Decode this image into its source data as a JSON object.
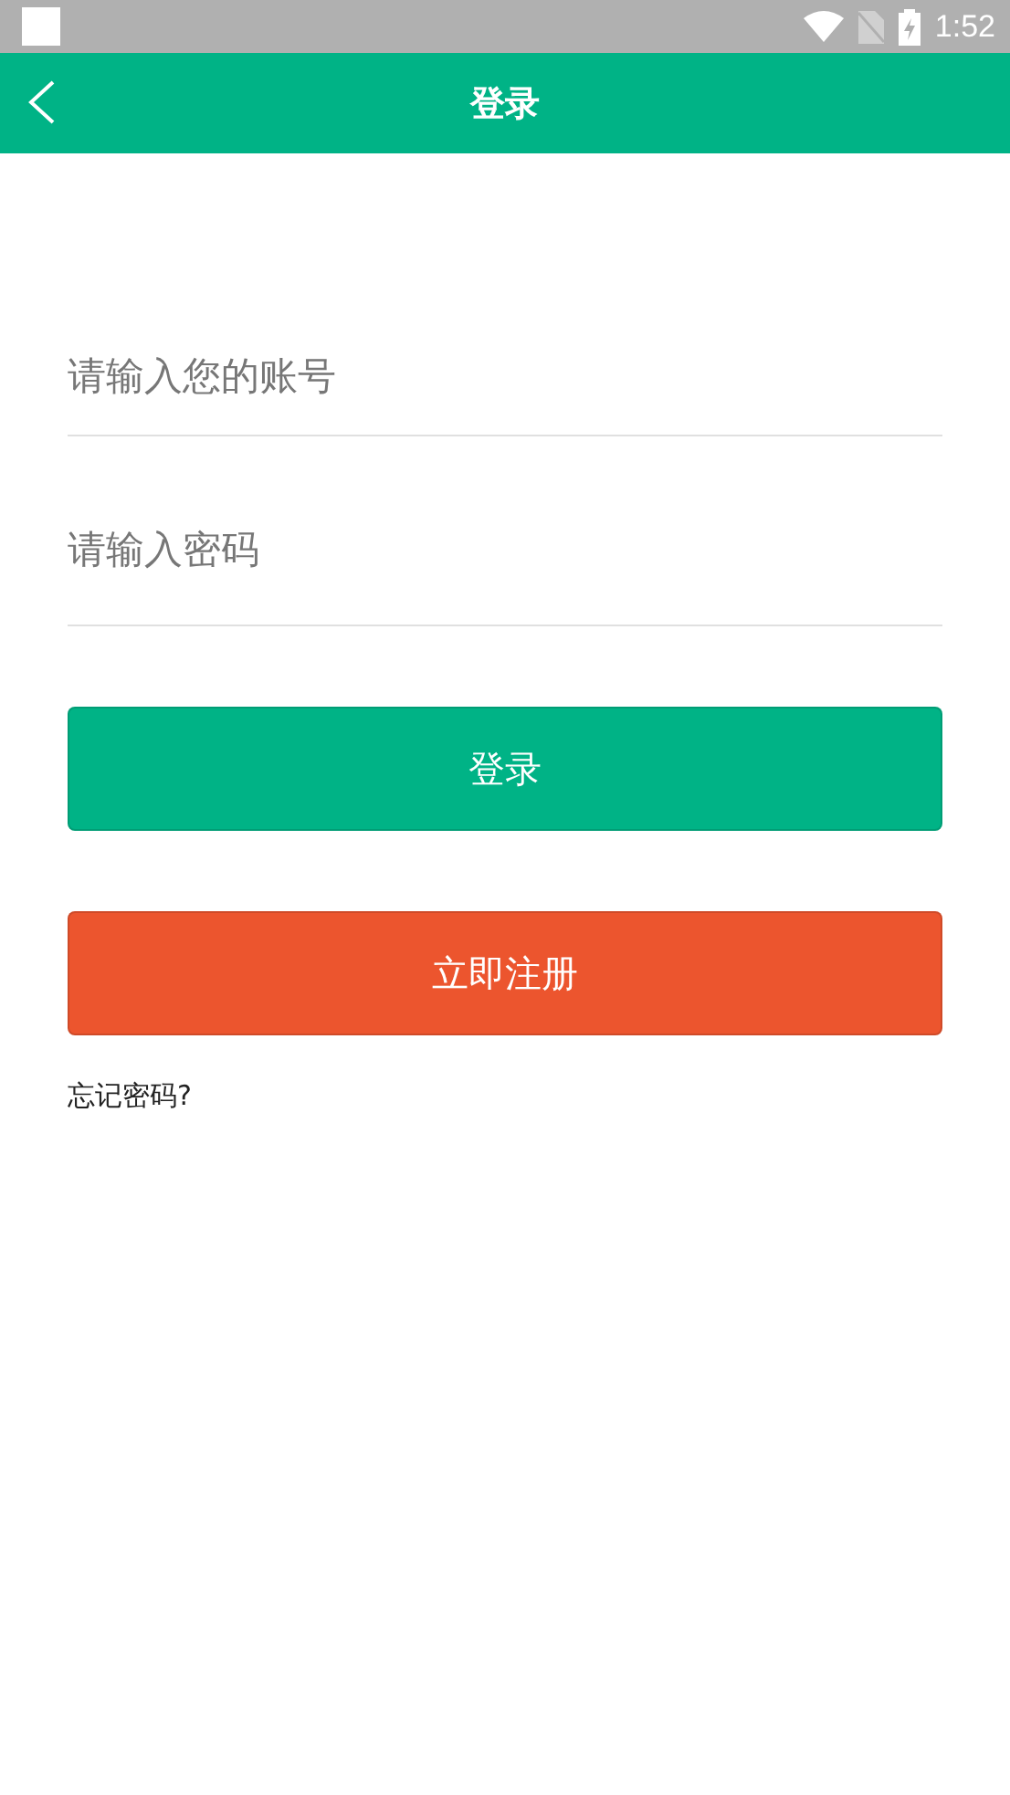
{
  "status_bar": {
    "time": "1:52"
  },
  "app_bar": {
    "title": "登录"
  },
  "form": {
    "account": {
      "placeholder": "请输入您的账号"
    },
    "password": {
      "placeholder": "请输入密码"
    }
  },
  "buttons": [
    {
      "label": "登录",
      "kind": "primary"
    },
    {
      "label": "立即注册",
      "kind": "danger"
    }
  ],
  "forgot_link": "忘记密码?"
}
